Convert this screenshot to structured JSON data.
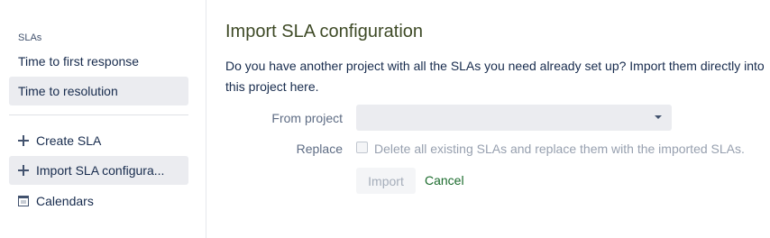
{
  "sidebar": {
    "section_title": "SLAs",
    "sla_items": [
      {
        "label": "Time to first response",
        "selected": false
      },
      {
        "label": "Time to resolution",
        "selected": true
      }
    ],
    "actions": [
      {
        "label": "Create SLA",
        "icon": "plus-icon"
      },
      {
        "label": "Import SLA configura...",
        "icon": "plus-icon",
        "selected": true
      },
      {
        "label": "Calendars",
        "icon": "calendar-icon"
      }
    ]
  },
  "main": {
    "title": "Import SLA configuration",
    "description": "Do you have another project with all the SLAs you need already set up? Import them directly into this project here.",
    "from_project_label": "From project",
    "from_project_value": "",
    "replace_label": "Replace",
    "replace_checkbox_text": "Delete all existing SLAs and replace them with the imported SLAs.",
    "replace_checked": false,
    "import_button": "Import",
    "cancel_link": "Cancel"
  },
  "colors": {
    "title": "#3e4a26",
    "cancel_link": "#1b6b2d",
    "selected_bg": "#ebecf0"
  }
}
